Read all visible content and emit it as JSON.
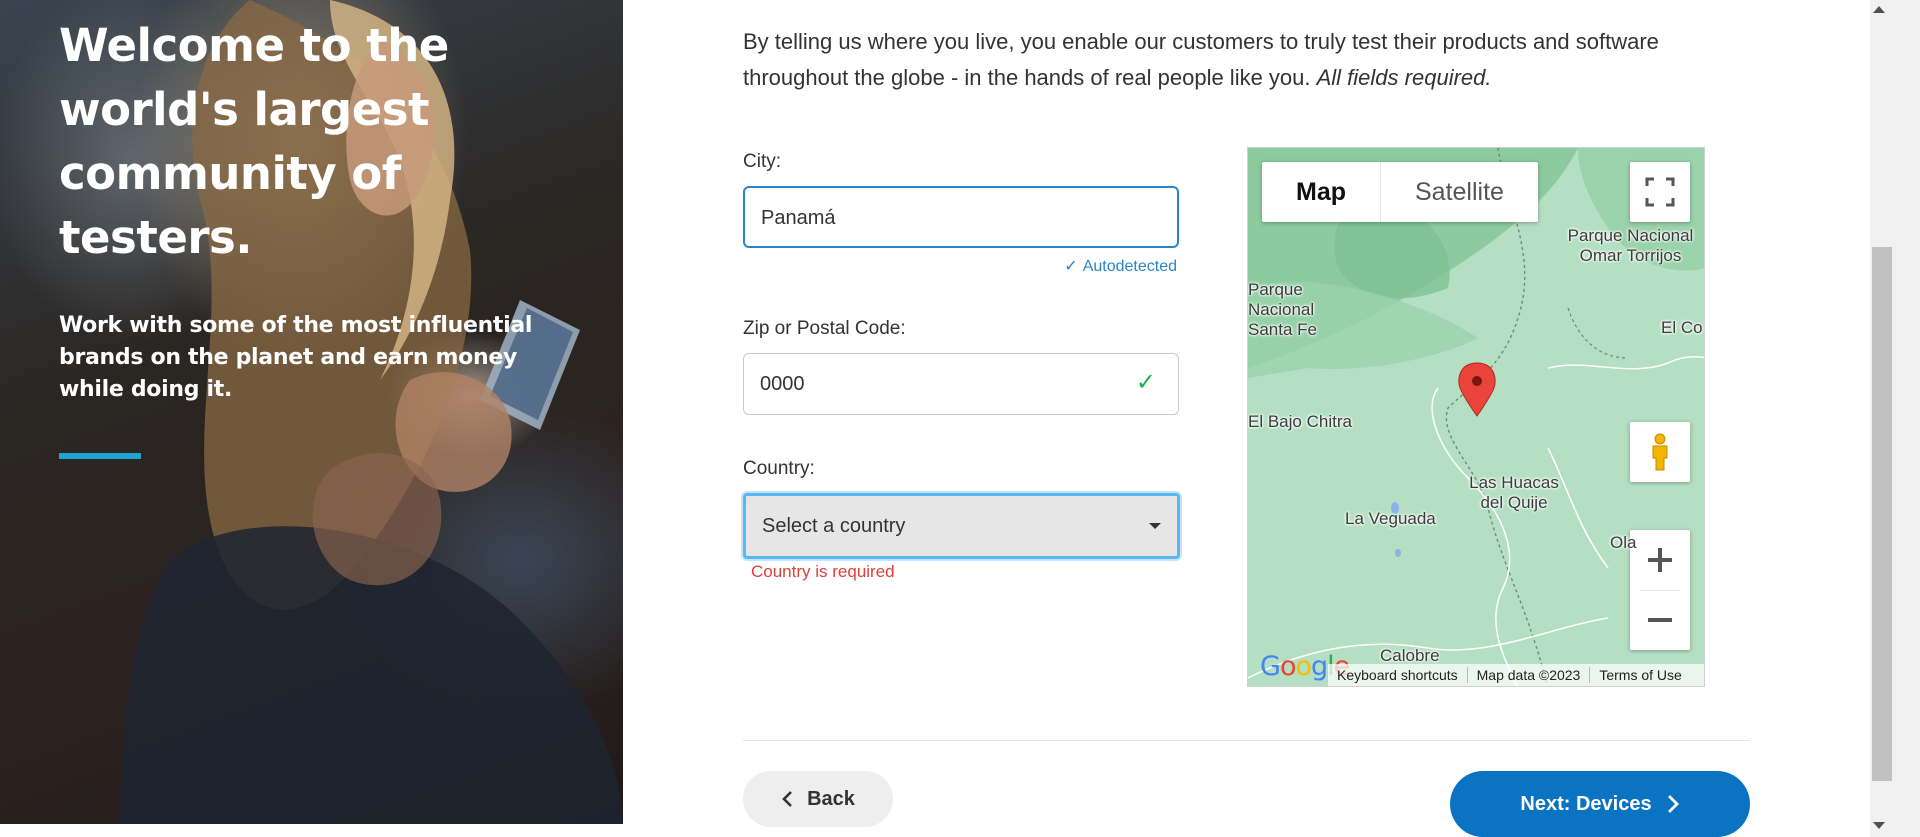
{
  "hero": {
    "title": "Welcome to the world's largest community of testers.",
    "subtitle": "Work with some of the most influential brands on the planet and earn money while doing it."
  },
  "intro": {
    "text": "By telling us where you live, you enable our customers to truly test their products and software throughout the globe - in the hands of real people like you.",
    "required_note": "All fields required."
  },
  "form": {
    "city": {
      "label": "City:",
      "value": "Panamá",
      "hint": "Autodetected"
    },
    "zip": {
      "label": "Zip or Postal Code:",
      "value": "0000"
    },
    "country": {
      "label": "Country:",
      "value": "Select a country",
      "error": "Country is required"
    }
  },
  "map": {
    "type_map": "Map",
    "type_satellite": "Satellite",
    "logo": "Google",
    "labels": {
      "parque_omar": "Parque Nacional Omar Torrijos",
      "parque_santa_fe": "Parque Nacional Santa Fe",
      "el_co": "El Co",
      "el_bajo_chitra": "El Bajo Chitra",
      "las_huacas": "Las Huacas del Quije",
      "la_veguada": "La Veguada",
      "ola": "Ola",
      "calobre": "Calobre"
    },
    "footer": {
      "shortcuts": "Keyboard shortcuts",
      "data": "Map data ©2023",
      "terms": "Terms of Use"
    }
  },
  "nav": {
    "back_label": "Back",
    "next_label": "Next: Devices"
  },
  "colors": {
    "accent": "#0a74c2",
    "hero_bar": "#1ea2d2",
    "error": "#e0403a",
    "success": "#22b14c"
  }
}
